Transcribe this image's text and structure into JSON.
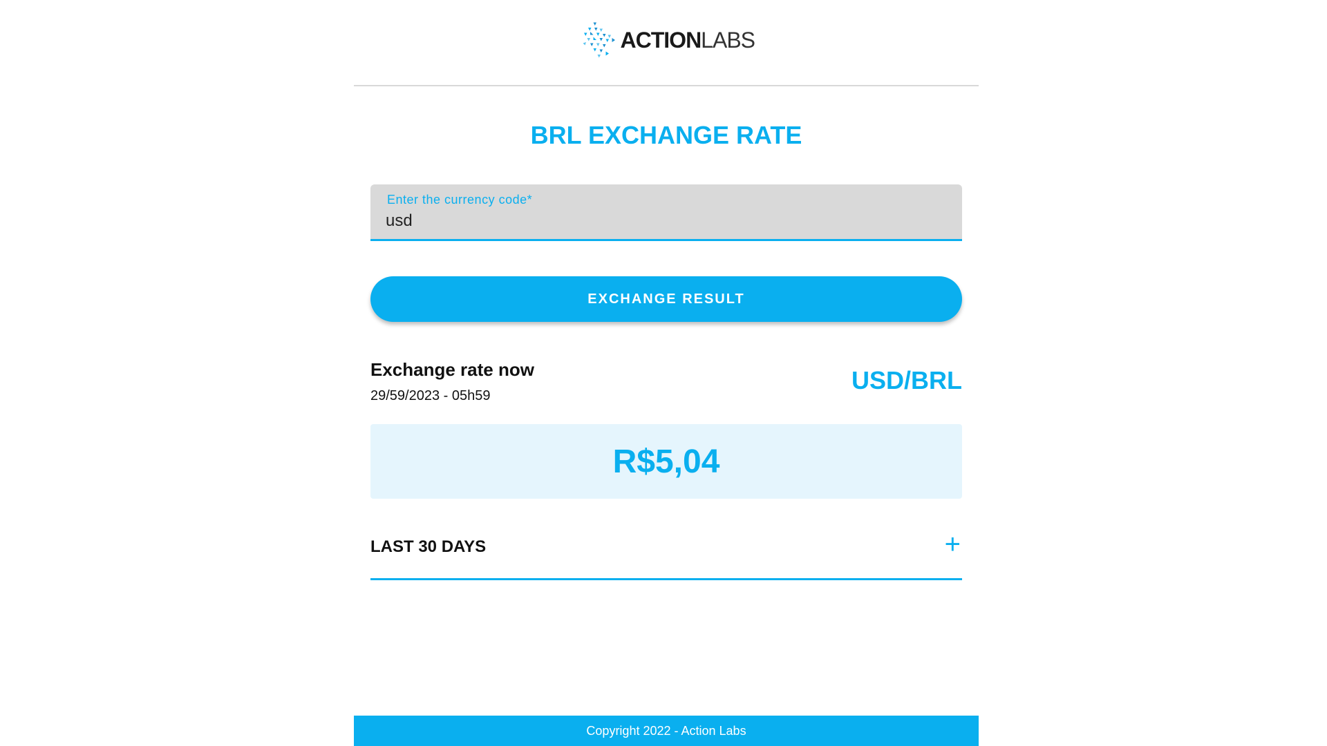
{
  "header": {
    "logo_bold": "ACTION",
    "logo_thin": "LABS",
    "logo_icon": "triangle-cluster-logo"
  },
  "title": "BRL EXCHANGE RATE",
  "form": {
    "label": "Enter the currency code*",
    "value": "usd",
    "button_label": "EXCHANGE RESULT"
  },
  "rate": {
    "heading": "Exchange rate now",
    "date": "29/59/2023 - 05h59",
    "pair": "USD/BRL",
    "value": "R$5,04"
  },
  "accordion": {
    "label": "LAST 30 DAYS",
    "icon": "plus-icon"
  },
  "footer": {
    "text": "Copyright 2022 - Action Labs"
  },
  "colors": {
    "accent": "#0aafef",
    "rate_box_bg": "#e5f5fd",
    "field_bg": "#d9d9d9"
  }
}
